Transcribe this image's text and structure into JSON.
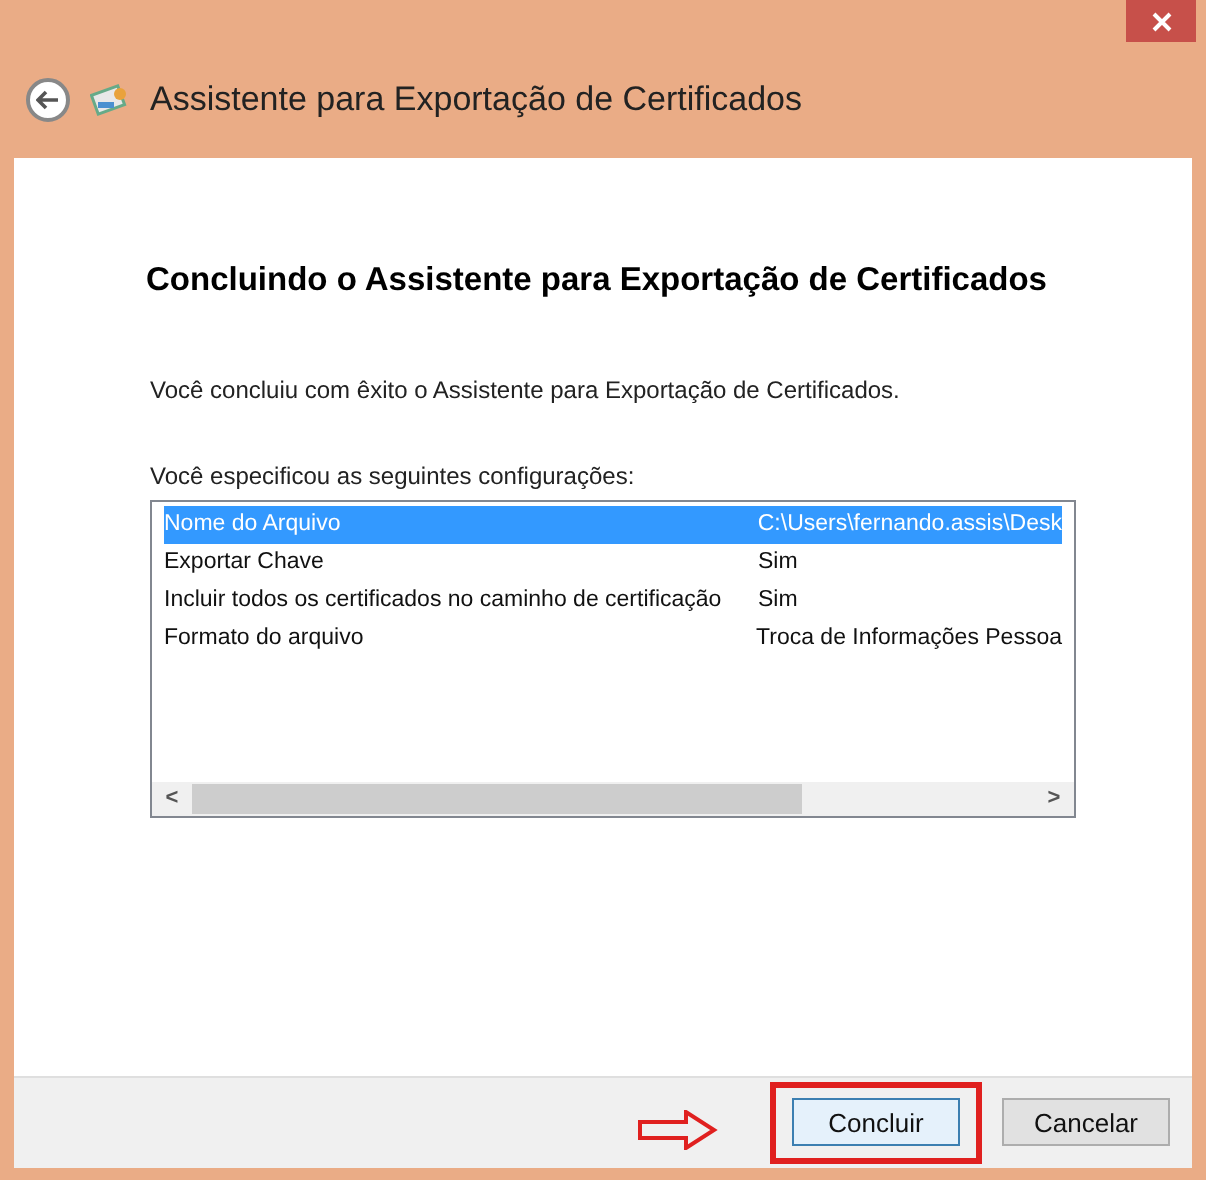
{
  "window": {
    "title": "Assistente para Exportação de Certificados"
  },
  "heading": "Concluindo o Assistente para Exportação de Certificados",
  "intro": "Você concluiu com êxito o Assistente para Exportação de Certificados.",
  "settings_label": "Você especificou as seguintes configurações:",
  "settings": [
    {
      "name": "Nome do Arquivo",
      "value": "C:\\Users\\fernando.assis\\Desk",
      "selected": true
    },
    {
      "name": "Exportar Chave",
      "value": "Sim",
      "selected": false
    },
    {
      "name": "Incluir todos os certificados no caminho de certificação",
      "value": "Sim",
      "selected": false
    },
    {
      "name": "Formato do arquivo",
      "value": "Troca de Informações Pessoa",
      "selected": false
    }
  ],
  "scroll_left": "<",
  "scroll_right": ">",
  "buttons": [
    {
      "label": "Concluir",
      "highlighted": true
    },
    {
      "label": "Cancelar",
      "highlighted": false
    }
  ]
}
